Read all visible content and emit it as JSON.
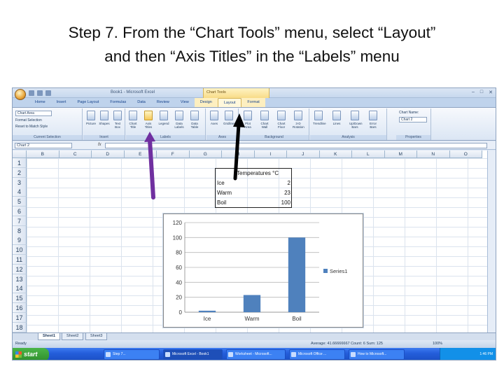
{
  "slide": {
    "title_line1": "Step 7. From the “Chart Tools” menu, select  “Layout”",
    "title_line2": "and then “Axis Titles” in the “Labels” menu"
  },
  "excel": {
    "window_title": "Book1 - Microsoft Excel",
    "context_group": "Chart Tools",
    "tabs": [
      "Home",
      "Insert",
      "Page Layout",
      "Formulas",
      "Data",
      "Review",
      "View",
      "Design",
      "Layout",
      "Format"
    ],
    "active_tab": "Layout",
    "ribbon": {
      "current_selection": {
        "dropdown_value": "Chart Area",
        "format_selection": "Format Selection",
        "reset": "Reset to Match Style",
        "label": "Current Selection"
      },
      "insert": {
        "buttons": [
          "Picture",
          "Shapes",
          "Text Box"
        ],
        "label": "Insert"
      },
      "labels": {
        "buttons": [
          "Chart Title",
          "Axis Titles",
          "Legend",
          "Data Labels",
          "Data Table"
        ],
        "label": "Labels"
      },
      "axes": {
        "buttons": [
          "Axes",
          "Gridlines"
        ],
        "label": "Axes"
      },
      "background": {
        "buttons": [
          "Plot Area",
          "Chart Wall",
          "Chart Floor",
          "3-D Rotation"
        ],
        "label": "Background"
      },
      "analysis": {
        "buttons": [
          "Trendline",
          "Lines",
          "Up/Down Bars",
          "Error Bars"
        ],
        "label": "Analysis"
      },
      "properties": {
        "chart_name_label": "Chart Name:",
        "chart_name_value": "Chart 2",
        "label": "Properties"
      }
    },
    "name_box": "Chart 2",
    "fx": "fx",
    "columns": [
      "B",
      "C",
      "D",
      "E",
      "F",
      "G",
      "H",
      "I",
      "J",
      "K",
      "L",
      "M",
      "N",
      "O"
    ],
    "rows": [
      "1",
      "2",
      "3",
      "4",
      "5",
      "6",
      "7",
      "8",
      "9",
      "10",
      "11",
      "12",
      "13",
      "14",
      "15",
      "16",
      "17",
      "18"
    ],
    "table": {
      "header": "Temperatures °C",
      "rows": [
        {
          "label": "Ice",
          "value": "2"
        },
        {
          "label": "Warm",
          "value": "23"
        },
        {
          "label": "Boil",
          "value": "100"
        }
      ]
    },
    "sheet_tabs": [
      "Sheet1",
      "Sheet2",
      "Sheet3"
    ],
    "status_left": "Ready",
    "status_right": "Average: 41.66666667    Count: 6    Sum: 125",
    "zoom": "100%",
    "taskbar": {
      "start": "start",
      "items": [
        "",
        "Step 7...",
        "Microsoft Excel - Book1",
        "Worksheet - Microsoft...",
        "Microsoft Office ...",
        "How to ...",
        "How to Microsoft..."
      ],
      "clock": "1:46 PM"
    }
  },
  "chart_data": {
    "type": "bar",
    "categories": [
      "Ice",
      "Warm",
      "Boil"
    ],
    "series": [
      {
        "name": "Series1",
        "values": [
          2,
          23,
          100
        ],
        "color": "#4f81bd"
      }
    ],
    "yticks": [
      "0",
      "20",
      "40",
      "60",
      "80",
      "100",
      "120"
    ],
    "ylim": [
      0,
      120
    ],
    "legend": "right"
  },
  "colors": {
    "arrow_purple": "#7030a0",
    "arrow_black": "#000000",
    "bar": "#4f81bd"
  }
}
